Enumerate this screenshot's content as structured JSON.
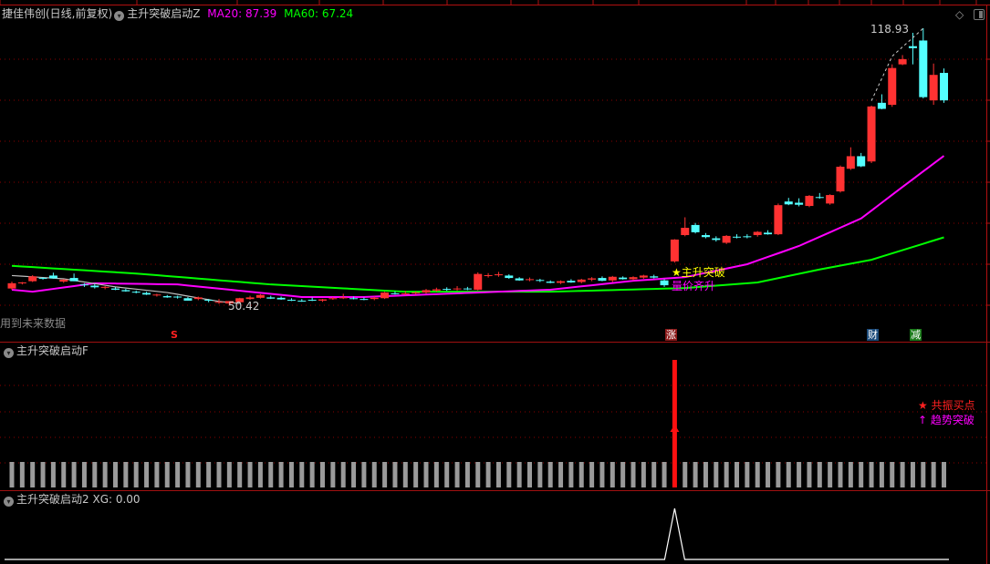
{
  "header": {
    "stock": "捷佳伟创(日线,前复权)",
    "indicator": "主升突破启动Z",
    "ma20_label": "MA20: 87.39",
    "ma60_label": "MA60: 67.24"
  },
  "panel_f": {
    "title": "主升突破启动F",
    "legend_buy": "★ 共振买点",
    "legend_trend": "↑ 趋势突破"
  },
  "panel_xg": {
    "title": "主升突破启动2",
    "value_label": "XG: 0.00"
  },
  "main": {
    "future_data_note": "用到未来数据",
    "high_label": "118.93",
    "low_label": "50.42",
    "signal_main": "★主升突破",
    "signal_sub": "量价齐升",
    "markers": {
      "s": "S",
      "zhang": "涨",
      "cai": "财",
      "jian": "减"
    }
  },
  "icons": [
    "dropdown-icon",
    "diamond-icon",
    "panel-toggle-icon"
  ],
  "colors": {
    "up": "#ff3232",
    "down": "#54ffff",
    "ma20": "#ff00ff",
    "ma60": "#00ff00",
    "grid": "#8b0000",
    "aux": "#c0c0c0"
  },
  "chart_data": {
    "type": "candlestick",
    "candles": [
      [
        54.6,
        56.3,
        54.3,
        55.9
      ],
      [
        56.0,
        56.2,
        55.6,
        56.1
      ],
      [
        56.4,
        57.9,
        56.2,
        57.6
      ],
      [
        57.2,
        57.4,
        56.8,
        57.0
      ],
      [
        57.8,
        58.5,
        57.0,
        57.1
      ],
      [
        56.3,
        56.9,
        56.0,
        56.8
      ],
      [
        57.2,
        58.3,
        56.4,
        56.4
      ],
      [
        55.6,
        55.9,
        55.0,
        55.5
      ],
      [
        55.3,
        55.7,
        54.6,
        54.9
      ],
      [
        54.8,
        55.2,
        54.4,
        55.0
      ],
      [
        54.6,
        54.9,
        54.2,
        54.3
      ],
      [
        54.2,
        54.5,
        53.8,
        53.9
      ],
      [
        53.8,
        54.1,
        53.4,
        53.6
      ],
      [
        53.5,
        53.8,
        53.0,
        53.1
      ],
      [
        53.0,
        53.3,
        52.6,
        53.1
      ],
      [
        52.7,
        53.0,
        52.3,
        52.4
      ],
      [
        52.6,
        52.8,
        52.1,
        52.4
      ],
      [
        52.2,
        52.5,
        51.6,
        51.6
      ],
      [
        52.0,
        52.6,
        51.7,
        52.4
      ],
      [
        51.8,
        52.0,
        51.2,
        51.7
      ],
      [
        51.3,
        52.0,
        50.8,
        51.3
      ],
      [
        50.9,
        51.5,
        50.42,
        51.5
      ],
      [
        51.2,
        52.3,
        51.0,
        52.2
      ],
      [
        52.0,
        52.8,
        51.8,
        52.4
      ],
      [
        52.3,
        53.2,
        52.1,
        53.0
      ],
      [
        52.4,
        52.8,
        52.0,
        52.1
      ],
      [
        52.3,
        52.6,
        51.8,
        51.9
      ],
      [
        51.8,
        52.2,
        51.5,
        51.6
      ],
      [
        51.6,
        52.0,
        51.3,
        51.5
      ],
      [
        51.8,
        52.4,
        51.5,
        51.6
      ],
      [
        51.6,
        52.0,
        51.3,
        51.9
      ],
      [
        52.1,
        52.5,
        51.8,
        52.2
      ],
      [
        52.3,
        53.3,
        52.0,
        52.4
      ],
      [
        52.2,
        52.6,
        51.9,
        52.1
      ],
      [
        52.0,
        52.4,
        51.7,
        51.8
      ],
      [
        52.0,
        52.6,
        51.7,
        52.3
      ],
      [
        52.2,
        53.8,
        52.0,
        53.6
      ],
      [
        53.4,
        53.9,
        53.1,
        53.2
      ],
      [
        53.3,
        54.0,
        53.0,
        53.4
      ],
      [
        53.4,
        53.9,
        53.1,
        53.6
      ],
      [
        53.6,
        54.5,
        53.3,
        54.2
      ],
      [
        54.1,
        54.8,
        53.8,
        54.4
      ],
      [
        54.5,
        54.9,
        54.0,
        54.3
      ],
      [
        54.4,
        55.2,
        54.1,
        54.6
      ],
      [
        54.6,
        55.0,
        54.2,
        54.4
      ],
      [
        54.3,
        58.6,
        54.1,
        58.2
      ],
      [
        57.7,
        58.4,
        57.3,
        57.9
      ],
      [
        57.9,
        58.7,
        57.5,
        58.1
      ],
      [
        57.8,
        58.1,
        57.0,
        57.2
      ],
      [
        57.1,
        57.4,
        56.5,
        56.6
      ],
      [
        56.8,
        57.3,
        56.4,
        56.9
      ],
      [
        56.7,
        57.0,
        56.2,
        56.5
      ],
      [
        56.3,
        56.6,
        55.9,
        56.0
      ],
      [
        56.0,
        56.6,
        55.7,
        56.4
      ],
      [
        56.5,
        56.9,
        56.0,
        56.1
      ],
      [
        56.2,
        57.0,
        55.9,
        56.8
      ],
      [
        56.8,
        57.4,
        56.4,
        57.1
      ],
      [
        57.2,
        57.6,
        56.4,
        56.5
      ],
      [
        56.6,
        57.7,
        56.2,
        57.5
      ],
      [
        57.3,
        57.6,
        56.8,
        56.9
      ],
      [
        56.9,
        57.6,
        56.6,
        57.4
      ],
      [
        57.3,
        58.0,
        57.0,
        57.8
      ],
      [
        57.6,
        58.0,
        57.1,
        57.3
      ],
      [
        56.6,
        56.9,
        55.0,
        55.4
      ],
      [
        61.3,
        66.8,
        61.0,
        66.7
      ],
      [
        67.8,
        72.2,
        67.5,
        69.6
      ],
      [
        70.3,
        70.8,
        68.2,
        68.5
      ],
      [
        67.8,
        68.3,
        67.0,
        67.3
      ],
      [
        67.0,
        67.5,
        66.2,
        66.6
      ],
      [
        65.9,
        67.8,
        65.6,
        67.6
      ],
      [
        67.4,
        68.0,
        67.0,
        67.3
      ],
      [
        67.5,
        68.0,
        67.0,
        67.3
      ],
      [
        67.8,
        68.8,
        67.4,
        68.6
      ],
      [
        68.4,
        69.0,
        67.9,
        68.0
      ],
      [
        68.0,
        75.6,
        67.8,
        75.2
      ],
      [
        76.1,
        77.0,
        75.2,
        75.4
      ],
      [
        75.8,
        76.9,
        74.9,
        75.3
      ],
      [
        75.0,
        77.7,
        74.7,
        77.5
      ],
      [
        77.2,
        78.2,
        76.8,
        77.0
      ],
      [
        75.6,
        77.9,
        75.3,
        77.7
      ],
      [
        78.6,
        85.0,
        78.3,
        84.7
      ],
      [
        84.2,
        89.5,
        83.9,
        87.3
      ],
      [
        87.3,
        88.1,
        84.6,
        84.8
      ],
      [
        86.0,
        99.8,
        85.6,
        99.6
      ],
      [
        100.5,
        102.6,
        98.9,
        99.0
      ],
      [
        100.0,
        110.0,
        99.5,
        109.1
      ],
      [
        110.0,
        112.3,
        109.8,
        111.3
      ],
      [
        114.5,
        117.8,
        110.0,
        114.0
      ],
      [
        115.9,
        118.93,
        101.6,
        101.9
      ],
      [
        101.1,
        110.2,
        100.0,
        107.4
      ],
      [
        107.9,
        109.0,
        100.5,
        101.1
      ]
    ],
    "ma20": [
      [
        0,
        54.3
      ],
      [
        2,
        53.8
      ],
      [
        8,
        55.9
      ],
      [
        16,
        55.6
      ],
      [
        28,
        52.5
      ],
      [
        34,
        52.5
      ],
      [
        43,
        53.4
      ],
      [
        52,
        54.3
      ],
      [
        60,
        56.5
      ],
      [
        65,
        57.4
      ],
      [
        71,
        60.6
      ],
      [
        76,
        65.1
      ],
      [
        82,
        71.9
      ],
      [
        86,
        79.7
      ],
      [
        90,
        87.39
      ]
    ],
    "ma60": [
      [
        0,
        60.2
      ],
      [
        12,
        58.3
      ],
      [
        25,
        55.6
      ],
      [
        38,
        53.8
      ],
      [
        52,
        53.8
      ],
      [
        65,
        54.7
      ],
      [
        72,
        56.1
      ],
      [
        78,
        59.3
      ],
      [
        83,
        61.7
      ],
      [
        90,
        67.24
      ]
    ],
    "aux_line": [
      [
        0,
        57.8
      ],
      [
        5,
        57.0
      ],
      [
        10,
        55.0
      ],
      [
        15,
        53.6
      ],
      [
        20,
        51.4
      ],
      [
        22,
        50.9
      ]
    ],
    "f_signal_index": 64,
    "xg_signal_index": 64,
    "marker_index": {
      "s": 15,
      "zhang": 64,
      "cai": 83,
      "jian": 87
    }
  }
}
